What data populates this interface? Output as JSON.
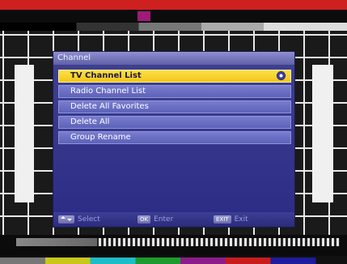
{
  "menu": {
    "title": "Channel",
    "items": [
      {
        "label": "TV Channel List",
        "selected": true
      },
      {
        "label": "Radio Channel List",
        "selected": false
      },
      {
        "label": "Delete All Favorites",
        "selected": false
      },
      {
        "label": "Delete All",
        "selected": false
      },
      {
        "label": "Group Rename",
        "selected": false
      }
    ]
  },
  "footer": {
    "select_label": "Select",
    "enter_key": "OK",
    "enter_label": "Enter",
    "exit_key": "EXIT",
    "exit_label": "Exit"
  },
  "colors": {
    "panel": "#2b2b86",
    "item": "#6a6fc4",
    "selected_item": "#f2c417",
    "test_card_red": "#cf2020"
  },
  "icons": {
    "selected_marker": "radio-dot-icon",
    "select_key": "up-down-arrows-icon"
  }
}
